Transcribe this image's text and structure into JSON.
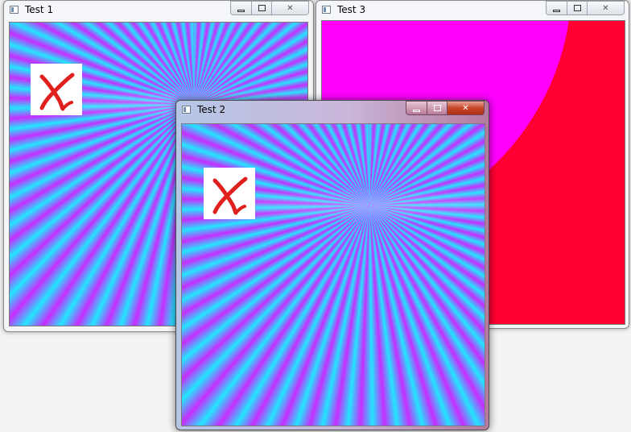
{
  "windows": [
    {
      "id": "test1",
      "title": "Test 1",
      "state": "inactive",
      "content": "ray-pattern"
    },
    {
      "id": "test3",
      "title": "Test 3",
      "state": "inactive",
      "content": "magenta-red"
    },
    {
      "id": "test2",
      "title": "Test 2",
      "state": "active",
      "content": "ray-pattern"
    }
  ],
  "caption_buttons": {
    "minimize_icon": "minimize-icon",
    "maximize_icon": "maximize-icon",
    "close_icon": "close-icon"
  },
  "colors": {
    "ray_cyan": "#22e6ff",
    "ray_magenta": "#c72dff",
    "test3_red": "#ff0033",
    "test3_magenta": "#ff00ff",
    "marker_red": "#e0201c"
  }
}
